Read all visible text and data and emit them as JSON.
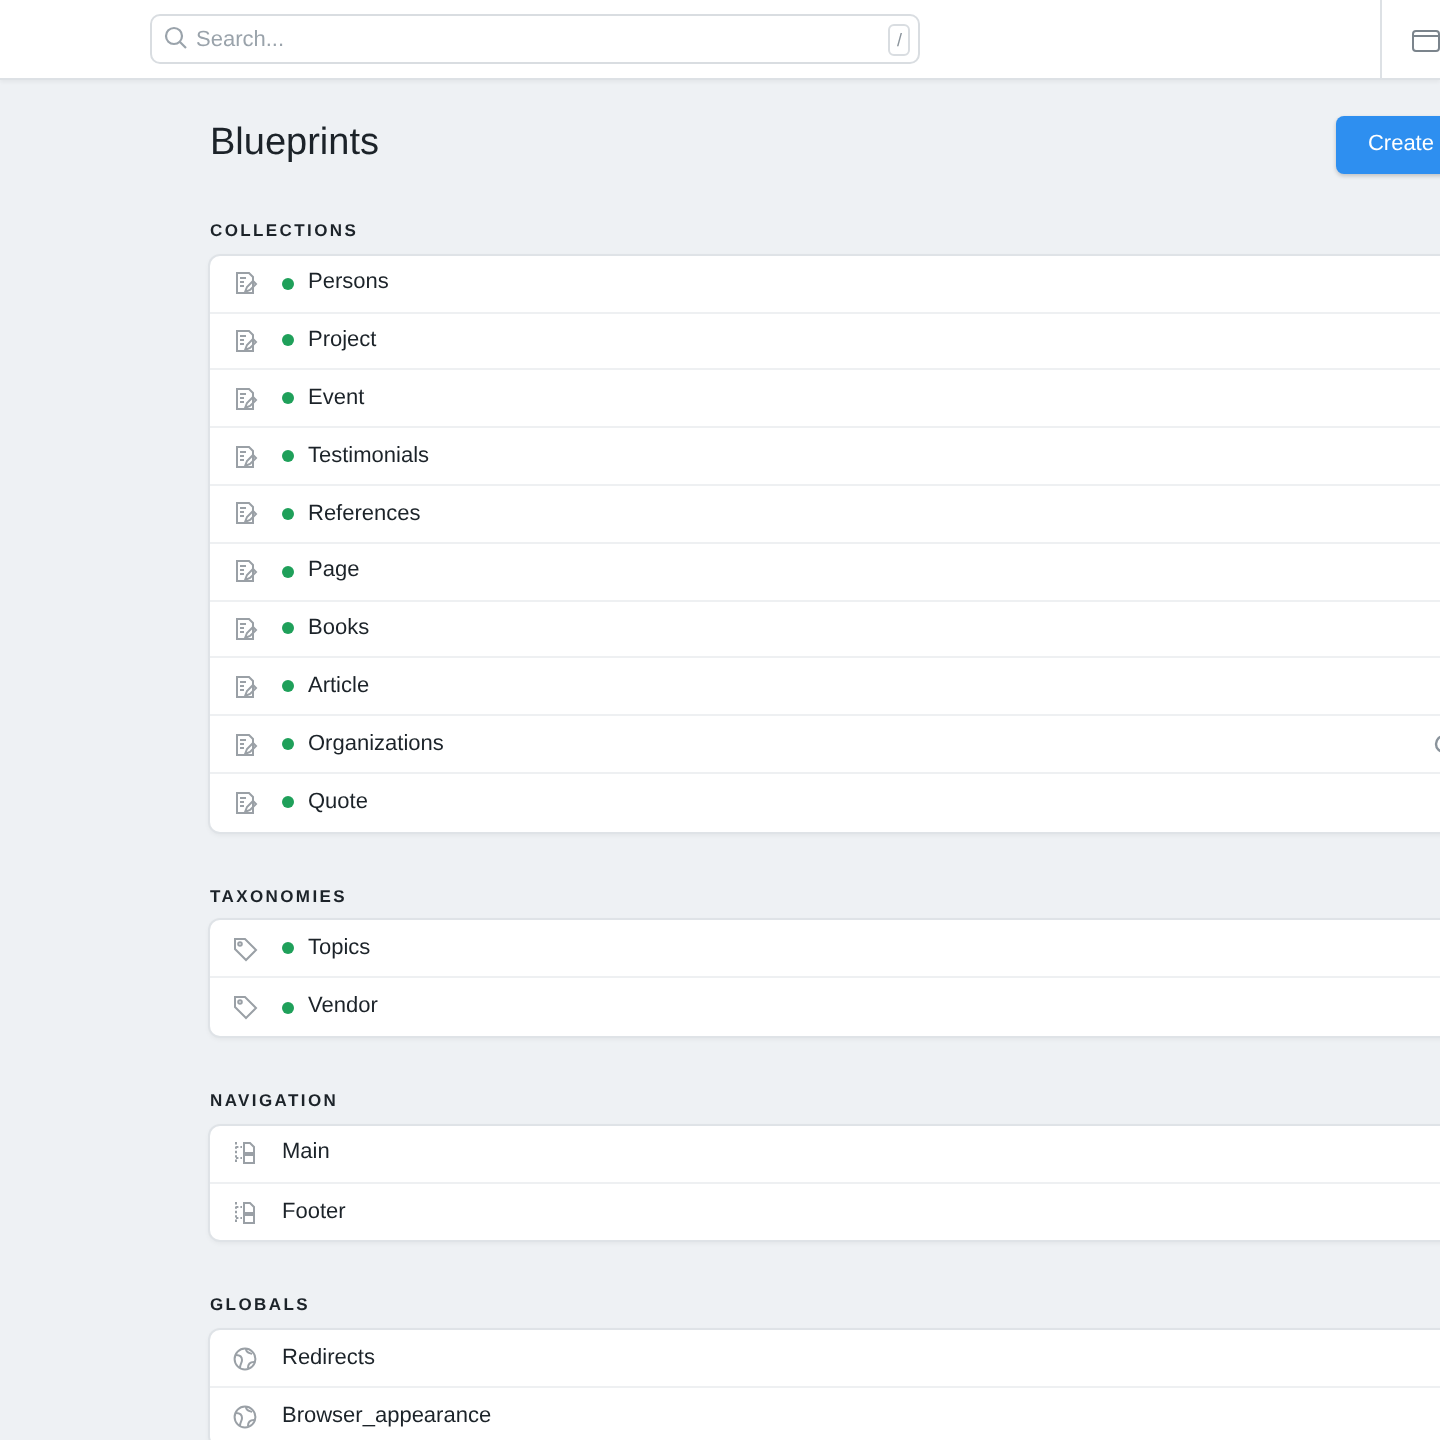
{
  "search": {
    "placeholder": "Search...",
    "shortcut": "/"
  },
  "page": {
    "title": "Blueprints",
    "create_button": "Create"
  },
  "sections": [
    {
      "title": "COLLECTIONS",
      "kind": "collection",
      "items": [
        {
          "name": "Persons",
          "published": true,
          "flag": false
        },
        {
          "name": "Project",
          "published": true,
          "flag": false
        },
        {
          "name": "Event",
          "published": true,
          "flag": false
        },
        {
          "name": "Testimonials",
          "published": true,
          "flag": false
        },
        {
          "name": "References",
          "published": true,
          "flag": false
        },
        {
          "name": "Page",
          "published": true,
          "flag": false
        },
        {
          "name": "Books",
          "published": true,
          "flag": false
        },
        {
          "name": "Article",
          "published": true,
          "flag": false
        },
        {
          "name": "Organizations",
          "published": true,
          "flag": true
        },
        {
          "name": "Quote",
          "published": true,
          "flag": false
        }
      ]
    },
    {
      "title": "TAXONOMIES",
      "kind": "taxonomy",
      "items": [
        {
          "name": "Topics",
          "published": true
        },
        {
          "name": "Vendor",
          "published": true
        }
      ]
    },
    {
      "title": "NAVIGATION",
      "kind": "navigation",
      "items": [
        {
          "name": "Main"
        },
        {
          "name": "Footer"
        }
      ]
    },
    {
      "title": "GLOBALS",
      "kind": "global",
      "items": [
        {
          "name": "Redirects"
        },
        {
          "name": "Browser_appearance"
        }
      ]
    }
  ]
}
